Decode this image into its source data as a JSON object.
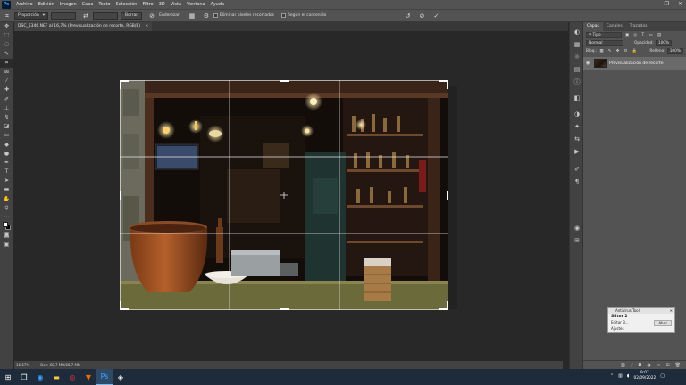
{
  "app": {
    "logo": "Ps"
  },
  "menu": [
    "Archivo",
    "Edición",
    "Imagen",
    "Capa",
    "Texto",
    "Selección",
    "Filtro",
    "3D",
    "Vista",
    "Ventana",
    "Ayuda"
  ],
  "window_controls": [
    "—",
    "❐",
    "✕"
  ],
  "options": {
    "ratio_select": "Proporción",
    "clear_button": "Borrar",
    "straighten_label": "Enderezar",
    "delete_pixels_label": "Eliminar píxeles recortados",
    "content_aware_label": "Según el contenido"
  },
  "document": {
    "tab_title": "DSC_5346.NEF al 16,7% (Previsualización de recorte, RGB/8)",
    "close": "×"
  },
  "status": {
    "zoom": "16,67%",
    "doc_size": "Doc: 68,7 MB/68,7 MB"
  },
  "layers_panel": {
    "tabs": [
      "Capas",
      "Canales",
      "Trazados"
    ],
    "kind_placeholder": "Tipo",
    "blend_mode": "Normal",
    "opacity_label": "Opacidad:",
    "opacity_value": "100%",
    "lock_label": "Bloq.:",
    "fill_label": "Relleno:",
    "fill_value": "100%",
    "layer_name": "Previsualización de recorte"
  },
  "widget": {
    "title": "Antivirus Tool",
    "name": "Slitor 2",
    "row_left": "Editar B...",
    "row_right": "Abrir",
    "footer": "Ajustes"
  },
  "taskbar": {
    "time": "9:07",
    "date": "02/09/2022"
  }
}
